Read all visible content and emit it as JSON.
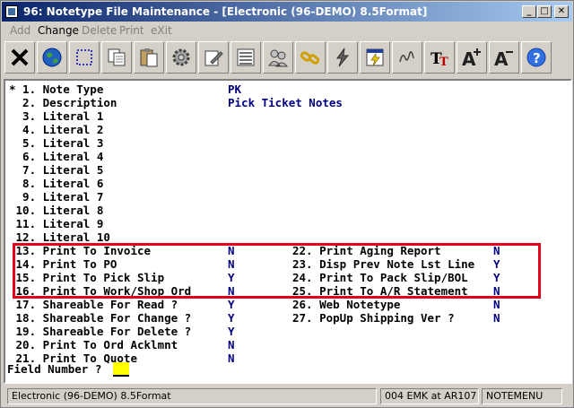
{
  "window": {
    "title": "96: Notetype File Maintenance - [Electronic (96-DEMO) 8.5Format]",
    "controls": {
      "minimize": "_",
      "maximize": "□",
      "close": "✕"
    }
  },
  "menu": [
    {
      "label": "Add",
      "enabled": false
    },
    {
      "label": "Change",
      "enabled": true
    },
    {
      "label": "Delete",
      "enabled": false
    },
    {
      "label": "Print",
      "enabled": false
    },
    {
      "label": "eXit",
      "enabled": false
    }
  ],
  "toolbar": [
    "close-x-icon",
    "globe-icon",
    "select-box-icon",
    "copy-icon",
    "paste-icon",
    "gear-icon",
    "edit-icon",
    "list-icon",
    "users-icon",
    "chain-icon",
    "lightning-icon",
    "calendar-icon",
    "signature-icon",
    "font-tt-icon",
    "font-larger-icon",
    "font-smaller-icon",
    "help-icon"
  ],
  "fields_left": [
    {
      "label": "* 1. Note Type",
      "value": "PK"
    },
    {
      "label": "  2. Description",
      "value": "Pick Ticket Notes"
    },
    {
      "label": "  3. Literal 1",
      "value": ""
    },
    {
      "label": "  4. Literal 2",
      "value": ""
    },
    {
      "label": "  5. Literal 3",
      "value": ""
    },
    {
      "label": "  6. Literal 4",
      "value": ""
    },
    {
      "label": "  7. Literal 5",
      "value": ""
    },
    {
      "label": "  8. Literal 6",
      "value": ""
    },
    {
      "label": "  9. Literal 7",
      "value": ""
    },
    {
      "label": " 10. Literal 8",
      "value": ""
    },
    {
      "label": " 11. Literal 9",
      "value": ""
    },
    {
      "label": " 12. Literal 10",
      "value": ""
    },
    {
      "label": " 13. Print To Invoice",
      "value": "N"
    },
    {
      "label": " 14. Print To PO",
      "value": "N"
    },
    {
      "label": " 15. Print To Pick Slip",
      "value": "Y"
    },
    {
      "label": " 16. Print To Work/Shop Ord",
      "value": "N"
    },
    {
      "label": " 17. Shareable For Read ?",
      "value": "Y"
    },
    {
      "label": " 18. Shareable For Change ?",
      "value": "Y"
    },
    {
      "label": " 19. Shareable For Delete ?",
      "value": "Y"
    },
    {
      "label": " 20. Print To Ord Acklmnt",
      "value": "N"
    },
    {
      "label": " 21. Print To Quote",
      "value": "N"
    }
  ],
  "fields_right": [
    {
      "label": "22. Print Aging Report",
      "value": "N"
    },
    {
      "label": "23. Disp Prev Note Lst Line",
      "value": "Y"
    },
    {
      "label": "24. Print To Pack Slip/BOL",
      "value": "Y"
    },
    {
      "label": "25. Print To A/R Statement",
      "value": "N"
    },
    {
      "label": "26. Web Notetype",
      "value": "N"
    },
    {
      "label": "27. PopUp Shipping Ver ?",
      "value": "N"
    }
  ],
  "prompt": {
    "label": "Field Number ?",
    "value": ""
  },
  "status": {
    "company": "Electronic (96-DEMO) 8.5Format",
    "session": "004 EMK at AR107",
    "menu": "NOTEMENU"
  },
  "colors": {
    "highlight_box": "#e3001b",
    "value_text": "#000080",
    "title_start": "#0a246a",
    "input_field": "#ffff00"
  }
}
